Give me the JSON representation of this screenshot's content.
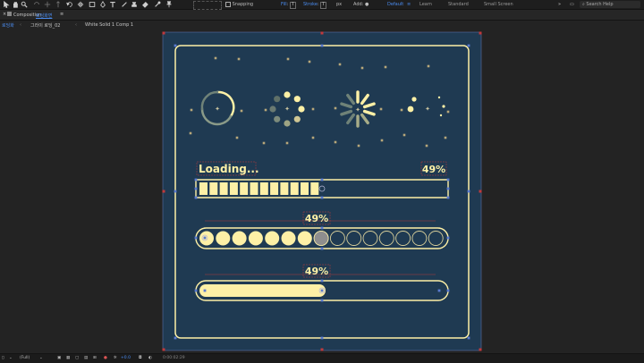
{
  "toolbar": {
    "snapping_label": "Snapping",
    "fill_label": "Fill",
    "fill_value": "T",
    "stroke_label": "Stroke",
    "stroke_value": "T",
    "stroke_width": "px",
    "add_label": "Add:",
    "workspaces": [
      "Default",
      "Learn",
      "Standard",
      "Small Screen"
    ],
    "search_placeholder": "Search Help"
  },
  "panel": {
    "title": "Composition",
    "comp_name": "로딩화면"
  },
  "breadcrumbs": [
    "로딩화",
    "그라이 로딩_02",
    "White Solid 1 Comp 1"
  ],
  "canvas": {
    "loading_text": "Loading...",
    "percent_top": "49%",
    "percent_middle": "49%",
    "percent_bottom": "49%",
    "progress_fraction": 0.49,
    "segment_bar_filled": 12,
    "segment_bar_total": 25,
    "dot_bar_filled": 7,
    "dot_bar_total": 15,
    "bg_color": "#1f3a52",
    "accent_color": "#fdf0a6"
  },
  "statusbar": {
    "zoom": "(Full)",
    "exposure": "+0.0",
    "timecode": "0:00:02:29"
  },
  "colors": {
    "ui_dark": "#232323",
    "selection_blue": "#4a8cf0",
    "handle_red": "#c0393c"
  }
}
